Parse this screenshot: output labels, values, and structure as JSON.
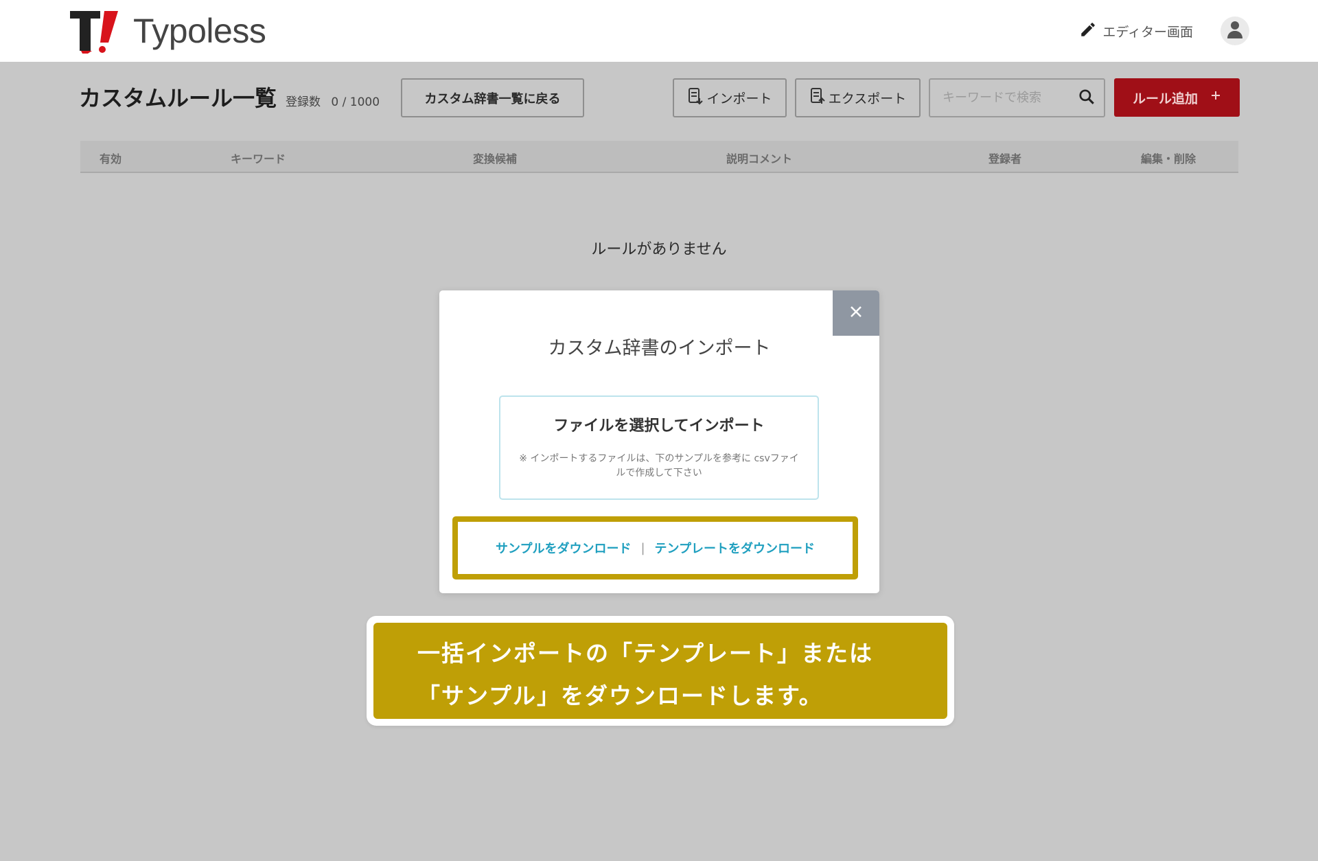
{
  "header": {
    "brand": "Typoless",
    "editor_link": "エディター画面"
  },
  "toolbar": {
    "title": "カスタムルール一覧",
    "count_label": "登録数",
    "count_value": "0 / 1000",
    "back_button": "カスタム辞書一覧に戻る",
    "import_button": "インポート",
    "export_button": "エクスポート",
    "search_placeholder": "キーワードで検索",
    "add_button": "ルール追加"
  },
  "table": {
    "columns": [
      "有効",
      "キーワード",
      "変換候補",
      "説明コメント",
      "登録者",
      "編集・削除"
    ],
    "empty_message": "ルールがありません"
  },
  "modal": {
    "title": "カスタム辞書のインポート",
    "file_select_title": "ファイルを選択してインポート",
    "file_select_note": "※ インポートするファイルは、下のサンプルを参考に csvファイルで作成して下さい",
    "download_sample": "サンプルをダウンロード",
    "separator": "|",
    "download_template": "テンプレートをダウンロード"
  },
  "callout": {
    "line1": "一括インポートの「テンプレート」または",
    "line2": "「サンプル」をダウンロードします。"
  },
  "colors": {
    "accent_red": "#a00f17",
    "highlight_gold": "#bf9f06",
    "link_blue": "#1f9fbf",
    "overlay_gray": "#c7c7c7"
  }
}
